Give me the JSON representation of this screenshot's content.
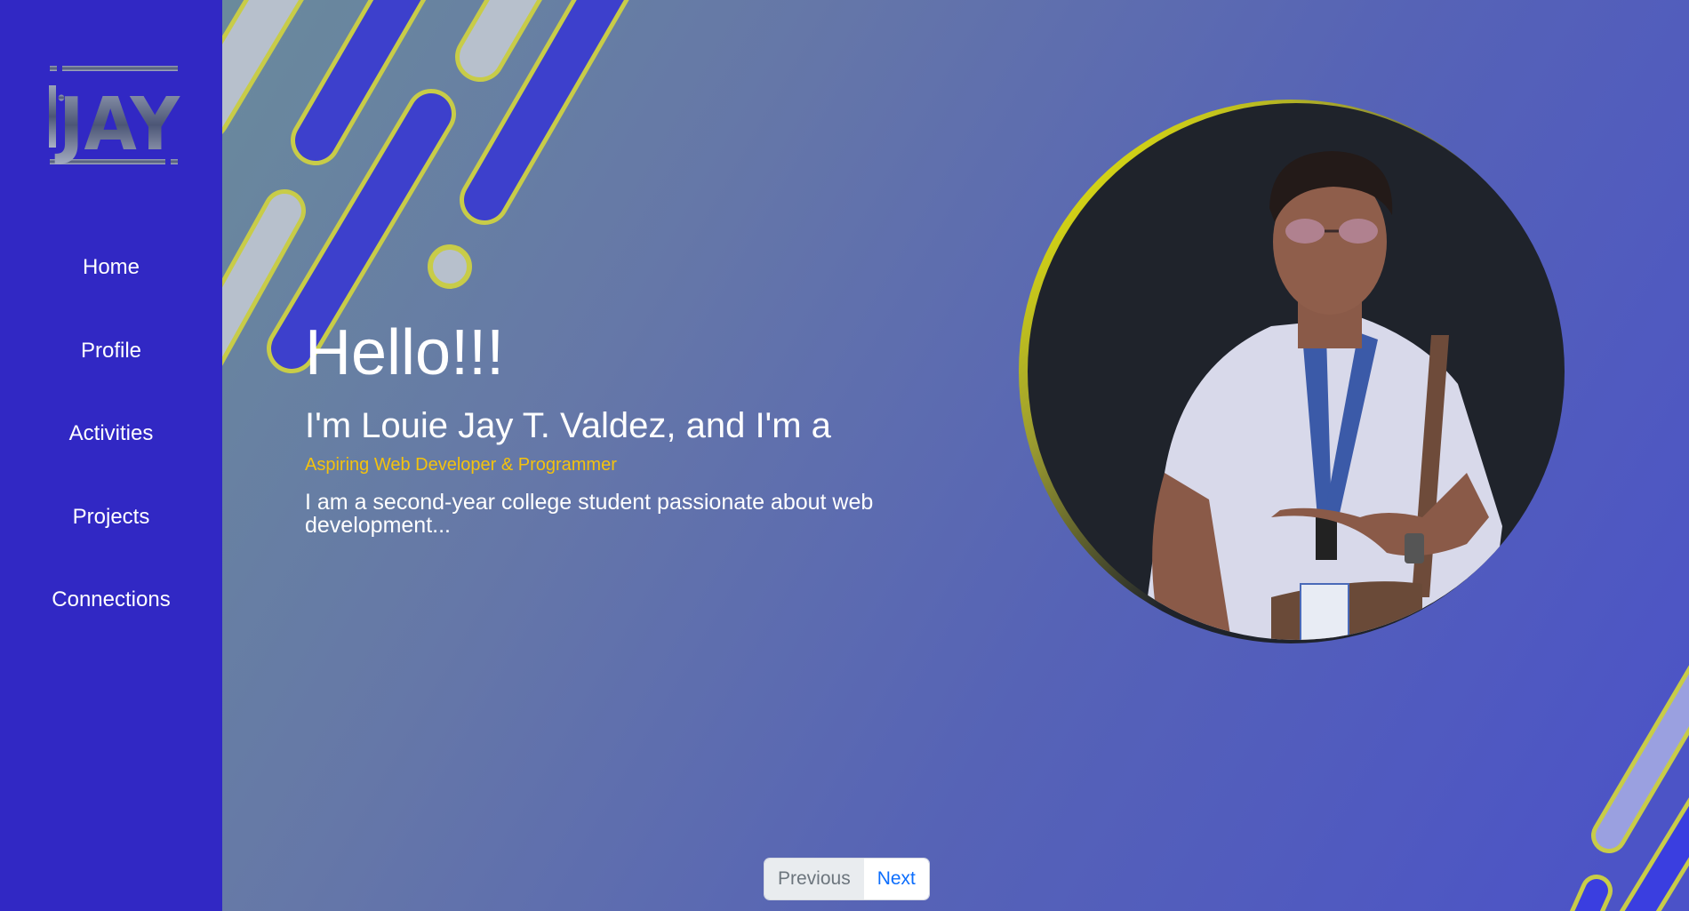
{
  "brand": {
    "logo_text": "JAY"
  },
  "sidebar": {
    "items": [
      {
        "label": "Home"
      },
      {
        "label": "Profile"
      },
      {
        "label": "Activities"
      },
      {
        "label": "Projects"
      },
      {
        "label": "Connections"
      }
    ]
  },
  "hero": {
    "greeting": "Hello!!!",
    "intro": "I'm Louie Jay T. Valdez, and I'm a",
    "role": "Aspiring Web Developer & Programmer",
    "description": "I am a second-year college student passionate about web development..."
  },
  "pagination": {
    "previous": "Previous",
    "next": "Next"
  },
  "colors": {
    "sidebar": "#3128c4",
    "accent_yellow": "#f4c20d",
    "ring_yellow": "#ffff00",
    "photo_bg": "#1f232b",
    "link_blue": "#0d6efd"
  }
}
